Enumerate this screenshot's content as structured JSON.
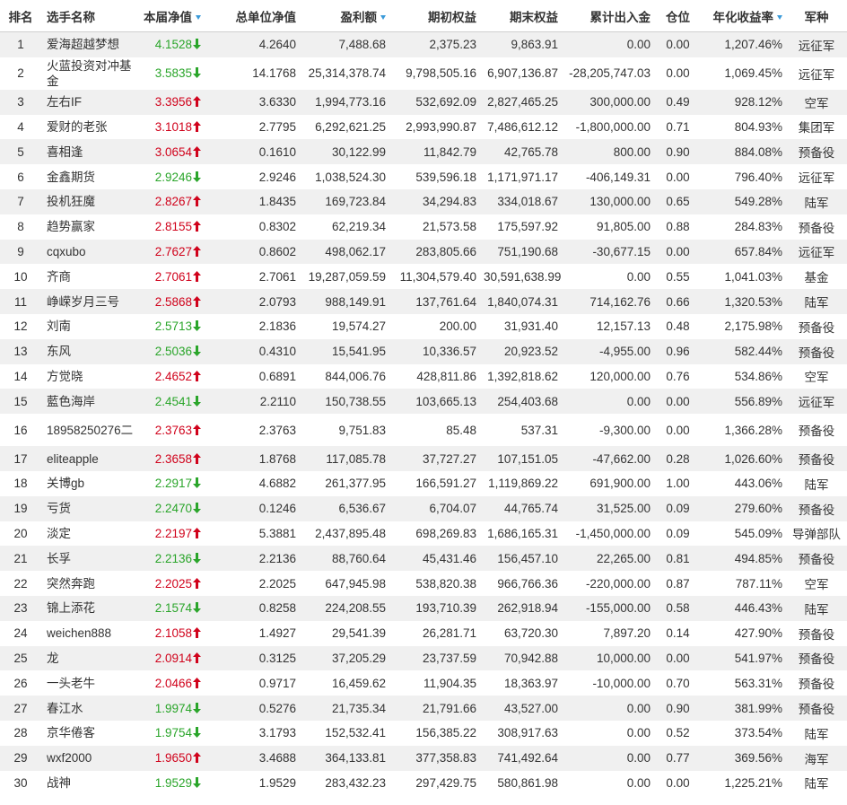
{
  "headers": {
    "rank": "排名",
    "name": "选手名称",
    "nav": "本届净值",
    "total_nav": "总单位净值",
    "profit": "盈利额",
    "start_equity": "期初权益",
    "end_equity": "期末权益",
    "net_flow": "累计出入金",
    "position": "仓位",
    "annual": "年化收益率",
    "corps": "军种"
  },
  "colors": {
    "up": "#d0021b",
    "down": "#2aa52a",
    "sort_icon": "#3a9ad9"
  },
  "rows": [
    {
      "rank": "1",
      "name": "爱海超越梦想",
      "nav": "4.1528",
      "dir": "down",
      "total_nav": "4.2640",
      "profit": "7,488.68",
      "start_equity": "2,375.23",
      "end_equity": "9,863.91",
      "net_flow": "0.00",
      "position": "0.00",
      "annual": "1,207.46%",
      "corps": "远征军"
    },
    {
      "rank": "2",
      "name": "火蓝投资对冲基金",
      "nav": "3.5835",
      "dir": "down",
      "total_nav": "14.1768",
      "profit": "25,314,378.74",
      "start_equity": "9,798,505.16",
      "end_equity": "6,907,136.87",
      "net_flow": "-28,205,747.03",
      "position": "0.00",
      "annual": "1,069.45%",
      "corps": "远征军"
    },
    {
      "rank": "3",
      "name": "左右IF",
      "nav": "3.3956",
      "dir": "up",
      "total_nav": "3.6330",
      "profit": "1,994,773.16",
      "start_equity": "532,692.09",
      "end_equity": "2,827,465.25",
      "net_flow": "300,000.00",
      "position": "0.49",
      "annual": "928.12%",
      "corps": "空军"
    },
    {
      "rank": "4",
      "name": "爱财的老张",
      "nav": "3.1018",
      "dir": "up",
      "total_nav": "2.7795",
      "profit": "6,292,621.25",
      "start_equity": "2,993,990.87",
      "end_equity": "7,486,612.12",
      "net_flow": "-1,800,000.00",
      "position": "0.71",
      "annual": "804.93%",
      "corps": "集团军"
    },
    {
      "rank": "5",
      "name": "喜相逢",
      "nav": "3.0654",
      "dir": "up",
      "total_nav": "0.1610",
      "profit": "30,122.99",
      "start_equity": "11,842.79",
      "end_equity": "42,765.78",
      "net_flow": "800.00",
      "position": "0.90",
      "annual": "884.08%",
      "corps": "预备役"
    },
    {
      "rank": "6",
      "name": "金鑫期货",
      "nav": "2.9246",
      "dir": "down",
      "total_nav": "2.9246",
      "profit": "1,038,524.30",
      "start_equity": "539,596.18",
      "end_equity": "1,171,971.17",
      "net_flow": "-406,149.31",
      "position": "0.00",
      "annual": "796.40%",
      "corps": "远征军"
    },
    {
      "rank": "7",
      "name": "投机狂魔",
      "nav": "2.8267",
      "dir": "up",
      "total_nav": "1.8435",
      "profit": "169,723.84",
      "start_equity": "34,294.83",
      "end_equity": "334,018.67",
      "net_flow": "130,000.00",
      "position": "0.65",
      "annual": "549.28%",
      "corps": "陆军"
    },
    {
      "rank": "8",
      "name": "趋势赢家",
      "nav": "2.8155",
      "dir": "up",
      "total_nav": "0.8302",
      "profit": "62,219.34",
      "start_equity": "21,573.58",
      "end_equity": "175,597.92",
      "net_flow": "91,805.00",
      "position": "0.88",
      "annual": "284.83%",
      "corps": "预备役"
    },
    {
      "rank": "9",
      "name": "cqxubo",
      "nav": "2.7627",
      "dir": "up",
      "total_nav": "0.8602",
      "profit": "498,062.17",
      "start_equity": "283,805.66",
      "end_equity": "751,190.68",
      "net_flow": "-30,677.15",
      "position": "0.00",
      "annual": "657.84%",
      "corps": "远征军"
    },
    {
      "rank": "10",
      "name": "齐商",
      "nav": "2.7061",
      "dir": "up",
      "total_nav": "2.7061",
      "profit": "19,287,059.59",
      "start_equity": "11,304,579.40",
      "end_equity": "30,591,638.99",
      "net_flow": "0.00",
      "position": "0.55",
      "annual": "1,041.03%",
      "corps": "基金"
    },
    {
      "rank": "11",
      "name": "峥嵘岁月三号",
      "nav": "2.5868",
      "dir": "up",
      "total_nav": "2.0793",
      "profit": "988,149.91",
      "start_equity": "137,761.64",
      "end_equity": "1,840,074.31",
      "net_flow": "714,162.76",
      "position": "0.66",
      "annual": "1,320.53%",
      "corps": "陆军"
    },
    {
      "rank": "12",
      "name": "刘南",
      "nav": "2.5713",
      "dir": "down",
      "total_nav": "2.1836",
      "profit": "19,574.27",
      "start_equity": "200.00",
      "end_equity": "31,931.40",
      "net_flow": "12,157.13",
      "position": "0.48",
      "annual": "2,175.98%",
      "corps": "预备役"
    },
    {
      "rank": "13",
      "name": "东风",
      "nav": "2.5036",
      "dir": "down",
      "total_nav": "0.4310",
      "profit": "15,541.95",
      "start_equity": "10,336.57",
      "end_equity": "20,923.52",
      "net_flow": "-4,955.00",
      "position": "0.96",
      "annual": "582.44%",
      "corps": "预备役"
    },
    {
      "rank": "14",
      "name": "方觉晓",
      "nav": "2.4652",
      "dir": "up",
      "total_nav": "0.6891",
      "profit": "844,006.76",
      "start_equity": "428,811.86",
      "end_equity": "1,392,818.62",
      "net_flow": "120,000.00",
      "position": "0.76",
      "annual": "534.86%",
      "corps": "空军"
    },
    {
      "rank": "15",
      "name": "藍色海岸",
      "nav": "2.4541",
      "dir": "down",
      "total_nav": "2.2110",
      "profit": "150,738.55",
      "start_equity": "103,665.13",
      "end_equity": "254,403.68",
      "net_flow": "0.00",
      "position": "0.00",
      "annual": "556.89%",
      "corps": "远征军"
    },
    {
      "rank": "16",
      "name": "18958250276二",
      "nav": "2.3763",
      "dir": "up",
      "total_nav": "2.3763",
      "profit": "9,751.83",
      "start_equity": "85.48",
      "end_equity": "537.31",
      "net_flow": "-9,300.00",
      "position": "0.00",
      "annual": "1,366.28%",
      "corps": "预备役"
    },
    {
      "rank": "17",
      "name": "eliteapple",
      "nav": "2.3658",
      "dir": "up",
      "total_nav": "1.8768",
      "profit": "117,085.78",
      "start_equity": "37,727.27",
      "end_equity": "107,151.05",
      "net_flow": "-47,662.00",
      "position": "0.28",
      "annual": "1,026.60%",
      "corps": "预备役"
    },
    {
      "rank": "18",
      "name": "关博gb",
      "nav": "2.2917",
      "dir": "down",
      "total_nav": "4.6882",
      "profit": "261,377.95",
      "start_equity": "166,591.27",
      "end_equity": "1,119,869.22",
      "net_flow": "691,900.00",
      "position": "1.00",
      "annual": "443.06%",
      "corps": "陆军"
    },
    {
      "rank": "19",
      "name": "亏货",
      "nav": "2.2470",
      "dir": "down",
      "total_nav": "0.1246",
      "profit": "6,536.67",
      "start_equity": "6,704.07",
      "end_equity": "44,765.74",
      "net_flow": "31,525.00",
      "position": "0.09",
      "annual": "279.60%",
      "corps": "预备役"
    },
    {
      "rank": "20",
      "name": "淡定",
      "nav": "2.2197",
      "dir": "up",
      "total_nav": "5.3881",
      "profit": "2,437,895.48",
      "start_equity": "698,269.83",
      "end_equity": "1,686,165.31",
      "net_flow": "-1,450,000.00",
      "position": "0.09",
      "annual": "545.09%",
      "corps": "导弹部队"
    },
    {
      "rank": "21",
      "name": "长孚",
      "nav": "2.2136",
      "dir": "down",
      "total_nav": "2.2136",
      "profit": "88,760.64",
      "start_equity": "45,431.46",
      "end_equity": "156,457.10",
      "net_flow": "22,265.00",
      "position": "0.81",
      "annual": "494.85%",
      "corps": "预备役"
    },
    {
      "rank": "22",
      "name": "突然奔跑",
      "nav": "2.2025",
      "dir": "up",
      "total_nav": "2.2025",
      "profit": "647,945.98",
      "start_equity": "538,820.38",
      "end_equity": "966,766.36",
      "net_flow": "-220,000.00",
      "position": "0.87",
      "annual": "787.11%",
      "corps": "空军"
    },
    {
      "rank": "23",
      "name": "锦上添花",
      "nav": "2.1574",
      "dir": "down",
      "total_nav": "0.8258",
      "profit": "224,208.55",
      "start_equity": "193,710.39",
      "end_equity": "262,918.94",
      "net_flow": "-155,000.00",
      "position": "0.58",
      "annual": "446.43%",
      "corps": "陆军"
    },
    {
      "rank": "24",
      "name": "weichen888",
      "nav": "2.1058",
      "dir": "up",
      "total_nav": "1.4927",
      "profit": "29,541.39",
      "start_equity": "26,281.71",
      "end_equity": "63,720.30",
      "net_flow": "7,897.20",
      "position": "0.14",
      "annual": "427.90%",
      "corps": "预备役"
    },
    {
      "rank": "25",
      "name": "龙",
      "nav": "2.0914",
      "dir": "up",
      "total_nav": "0.3125",
      "profit": "37,205.29",
      "start_equity": "23,737.59",
      "end_equity": "70,942.88",
      "net_flow": "10,000.00",
      "position": "0.00",
      "annual": "541.97%",
      "corps": "预备役"
    },
    {
      "rank": "26",
      "name": "一头老牛",
      "nav": "2.0466",
      "dir": "up",
      "total_nav": "0.9717",
      "profit": "16,459.62",
      "start_equity": "11,904.35",
      "end_equity": "18,363.97",
      "net_flow": "-10,000.00",
      "position": "0.70",
      "annual": "563.31%",
      "corps": "预备役"
    },
    {
      "rank": "27",
      "name": "春江水",
      "nav": "1.9974",
      "dir": "down",
      "total_nav": "0.5276",
      "profit": "21,735.34",
      "start_equity": "21,791.66",
      "end_equity": "43,527.00",
      "net_flow": "0.00",
      "position": "0.90",
      "annual": "381.99%",
      "corps": "预备役"
    },
    {
      "rank": "28",
      "name": "京华倦客",
      "nav": "1.9754",
      "dir": "down",
      "total_nav": "3.1793",
      "profit": "152,532.41",
      "start_equity": "156,385.22",
      "end_equity": "308,917.63",
      "net_flow": "0.00",
      "position": "0.52",
      "annual": "373.54%",
      "corps": "陆军"
    },
    {
      "rank": "29",
      "name": "wxf2000",
      "nav": "1.9650",
      "dir": "up",
      "total_nav": "3.4688",
      "profit": "364,133.81",
      "start_equity": "377,358.83",
      "end_equity": "741,492.64",
      "net_flow": "0.00",
      "position": "0.77",
      "annual": "369.56%",
      "corps": "海军"
    },
    {
      "rank": "30",
      "name": "战神",
      "nav": "1.9529",
      "dir": "down",
      "total_nav": "1.9529",
      "profit": "283,432.23",
      "start_equity": "297,429.75",
      "end_equity": "580,861.98",
      "net_flow": "0.00",
      "position": "0.00",
      "annual": "1,225.21%",
      "corps": "陆军"
    }
  ]
}
